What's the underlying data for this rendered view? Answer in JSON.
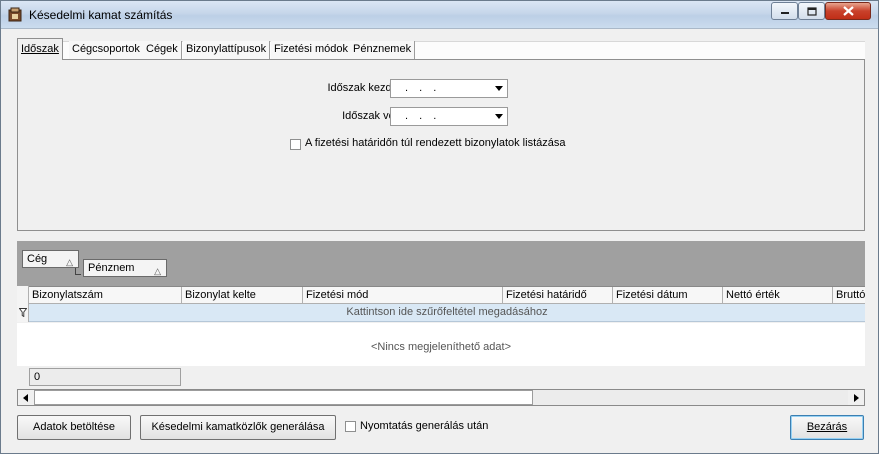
{
  "window": {
    "title": "Késedelmi kamat számítás"
  },
  "tabs": [
    {
      "label": "Időszak",
      "active": true
    },
    {
      "label": "Cégcsoportok"
    },
    {
      "label": "Cégek"
    },
    {
      "label": "Bizonylattípusok"
    },
    {
      "label": "Fizetési módok"
    },
    {
      "label": "Pénznemek"
    }
  ],
  "filters": {
    "period_start_label": "Időszak kezdete:",
    "period_start_value": ". . .",
    "period_end_label": "Időszak vége:",
    "period_end_value": ". . .",
    "overdue_checkbox_label": "A fizetési határidőn túl rendezett bizonylatok listázása",
    "overdue_checked": false
  },
  "grid": {
    "group_chips": [
      "Cég",
      "Pénznem"
    ],
    "columns": [
      "Bizonylatszám",
      "Bizonylat kelte",
      "Fizetési mód",
      "Fizetési határidő",
      "Fizetési dátum",
      "Nettó érték",
      "Bruttó"
    ],
    "filter_row_text": "Kattintson ide szűrőfeltétel megadásához",
    "empty_text": "<Nincs megjeleníthető adat>",
    "summary_value": "0"
  },
  "actions": {
    "load_label": "Adatok betöltése",
    "generate_label": "Késedelmi kamatközlők generálása",
    "print_after_label": "Nyomtatás generálás után",
    "print_after_checked": false,
    "close_label": "Bezárás"
  },
  "colors": {
    "titlebar": "#c6d6ea",
    "groupbar": "#a0a0a0",
    "filter_row": "#d9e8f5",
    "close_button": "#c02e17"
  }
}
